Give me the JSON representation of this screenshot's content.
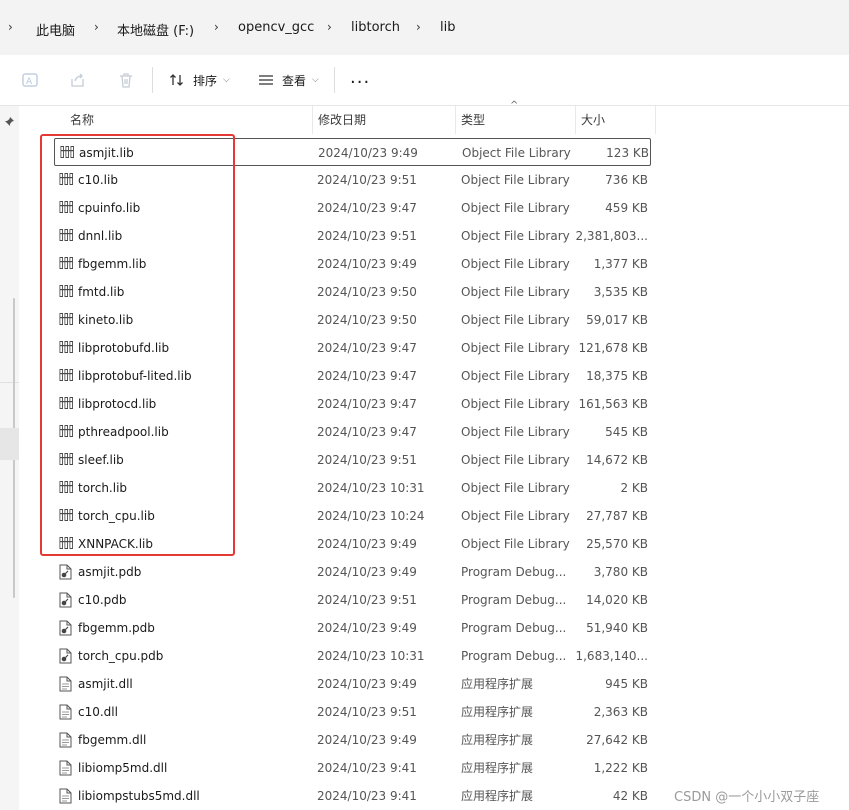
{
  "address_bar": {
    "breadcrumbs": [
      "此电脑",
      "本地磁盘 (F:)",
      "opencv_gcc",
      "libtorch",
      "lib"
    ]
  },
  "toolbar": {
    "sort_label": "排序",
    "view_label": "查看",
    "more_label": "..."
  },
  "columns": {
    "name": "名称",
    "date": "修改日期",
    "type": "类型",
    "size": "大小"
  },
  "files": [
    {
      "name": "asmjit.lib",
      "date": "2024/10/23 9:49",
      "type": "Object File Library",
      "size": "123 KB",
      "icon": "lib-icon"
    },
    {
      "name": "c10.lib",
      "date": "2024/10/23 9:51",
      "type": "Object File Library",
      "size": "736 KB",
      "icon": "lib-icon"
    },
    {
      "name": "cpuinfo.lib",
      "date": "2024/10/23 9:47",
      "type": "Object File Library",
      "size": "459 KB",
      "icon": "lib-icon"
    },
    {
      "name": "dnnl.lib",
      "date": "2024/10/23 9:51",
      "type": "Object File Library",
      "size": "2,381,803...",
      "icon": "lib-icon"
    },
    {
      "name": "fbgemm.lib",
      "date": "2024/10/23 9:49",
      "type": "Object File Library",
      "size": "1,377 KB",
      "icon": "lib-icon"
    },
    {
      "name": "fmtd.lib",
      "date": "2024/10/23 9:50",
      "type": "Object File Library",
      "size": "3,535 KB",
      "icon": "lib-icon"
    },
    {
      "name": "kineto.lib",
      "date": "2024/10/23 9:50",
      "type": "Object File Library",
      "size": "59,017 KB",
      "icon": "lib-icon"
    },
    {
      "name": "libprotobufd.lib",
      "date": "2024/10/23 9:47",
      "type": "Object File Library",
      "size": "121,678 KB",
      "icon": "lib-icon"
    },
    {
      "name": "libprotobuf-lited.lib",
      "date": "2024/10/23 9:47",
      "type": "Object File Library",
      "size": "18,375 KB",
      "icon": "lib-icon"
    },
    {
      "name": "libprotocd.lib",
      "date": "2024/10/23 9:47",
      "type": "Object File Library",
      "size": "161,563 KB",
      "icon": "lib-icon"
    },
    {
      "name": "pthreadpool.lib",
      "date": "2024/10/23 9:47",
      "type": "Object File Library",
      "size": "545 KB",
      "icon": "lib-icon"
    },
    {
      "name": "sleef.lib",
      "date": "2024/10/23 9:51",
      "type": "Object File Library",
      "size": "14,672 KB",
      "icon": "lib-icon"
    },
    {
      "name": "torch.lib",
      "date": "2024/10/23 10:31",
      "type": "Object File Library",
      "size": "2 KB",
      "icon": "lib-icon"
    },
    {
      "name": "torch_cpu.lib",
      "date": "2024/10/23 10:24",
      "type": "Object File Library",
      "size": "27,787 KB",
      "icon": "lib-icon"
    },
    {
      "name": "XNNPACK.lib",
      "date": "2024/10/23 9:49",
      "type": "Object File Library",
      "size": "25,570 KB",
      "icon": "lib-icon"
    },
    {
      "name": "asmjit.pdb",
      "date": "2024/10/23 9:49",
      "type": "Program Debug...",
      "size": "3,780 KB",
      "icon": "pdb-icon"
    },
    {
      "name": "c10.pdb",
      "date": "2024/10/23 9:51",
      "type": "Program Debug...",
      "size": "14,020 KB",
      "icon": "pdb-icon"
    },
    {
      "name": "fbgemm.pdb",
      "date": "2024/10/23 9:49",
      "type": "Program Debug...",
      "size": "51,940 KB",
      "icon": "pdb-icon"
    },
    {
      "name": "torch_cpu.pdb",
      "date": "2024/10/23 10:31",
      "type": "Program Debug...",
      "size": "1,683,140...",
      "icon": "pdb-icon"
    },
    {
      "name": "asmjit.dll",
      "date": "2024/10/23 9:49",
      "type": "应用程序扩展",
      "size": "945 KB",
      "icon": "dll-icon"
    },
    {
      "name": "c10.dll",
      "date": "2024/10/23 9:51",
      "type": "应用程序扩展",
      "size": "2,363 KB",
      "icon": "dll-icon"
    },
    {
      "name": "fbgemm.dll",
      "date": "2024/10/23 9:49",
      "type": "应用程序扩展",
      "size": "27,642 KB",
      "icon": "dll-icon"
    },
    {
      "name": "libiomp5md.dll",
      "date": "2024/10/23 9:41",
      "type": "应用程序扩展",
      "size": "1,222 KB",
      "icon": "dll-icon"
    },
    {
      "name": "libiompstubs5md.dll",
      "date": "2024/10/23 9:41",
      "type": "应用程序扩展",
      "size": "42 KB",
      "icon": "dll-icon"
    }
  ],
  "focused_row_index": 0,
  "colors": {
    "highlight_box": "#e53935",
    "focus_border": "#555555"
  },
  "watermark": "CSDN @一个小小双子座"
}
